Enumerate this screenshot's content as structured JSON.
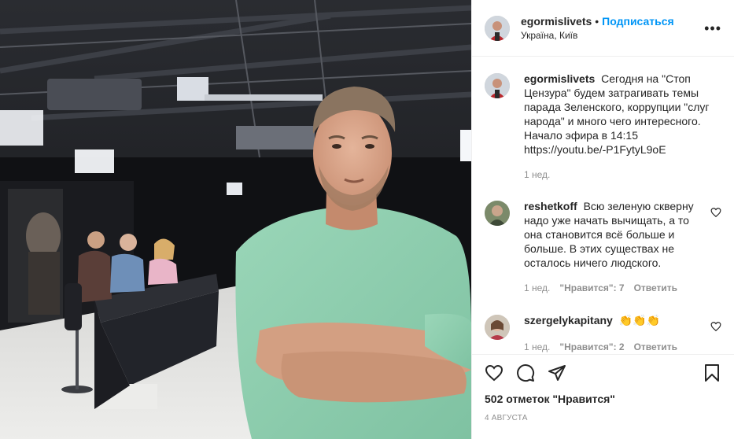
{
  "post": {
    "username": "egormislivets",
    "separator": "•",
    "follow_label": "Подписаться",
    "location": "Україна, Київ",
    "more_label": "•••"
  },
  "caption": {
    "username": "egormislivets",
    "text": "Сегодня на \"Стоп Цензура\" будем затрагивать темы парада Зеленского, коррупции \"слуг народа\" и много чего интересного. Начало эфира в 14:15 https://youtu.be/-P1FytyL9oE",
    "time": "1 нед."
  },
  "comments": [
    {
      "username": "reshetkoff",
      "text": "Всю зеленую скверну надо уже начать вычищать, а то она становится всё больше и больше. В этих существах не осталось ничего людского.",
      "time": "1 нед.",
      "likes": "\"Нравится\": 7",
      "reply_label": "Ответить"
    },
    {
      "username": "szergelykapitany",
      "text": "👏👏👏",
      "time": "1 нед.",
      "likes": "\"Нравится\": 2",
      "reply_label": "Ответить"
    }
  ],
  "actions": {
    "icons": [
      "heart-icon",
      "comment-icon",
      "share-icon",
      "bookmark-icon"
    ],
    "likes_text": "502 отметок \"Нравится\"",
    "date": "4 АВГУСТА"
  },
  "colors": {
    "link": "#0095f6",
    "secondary": "#8e8e8e",
    "border": "#efefef",
    "shirt": "#8fcfb0"
  }
}
